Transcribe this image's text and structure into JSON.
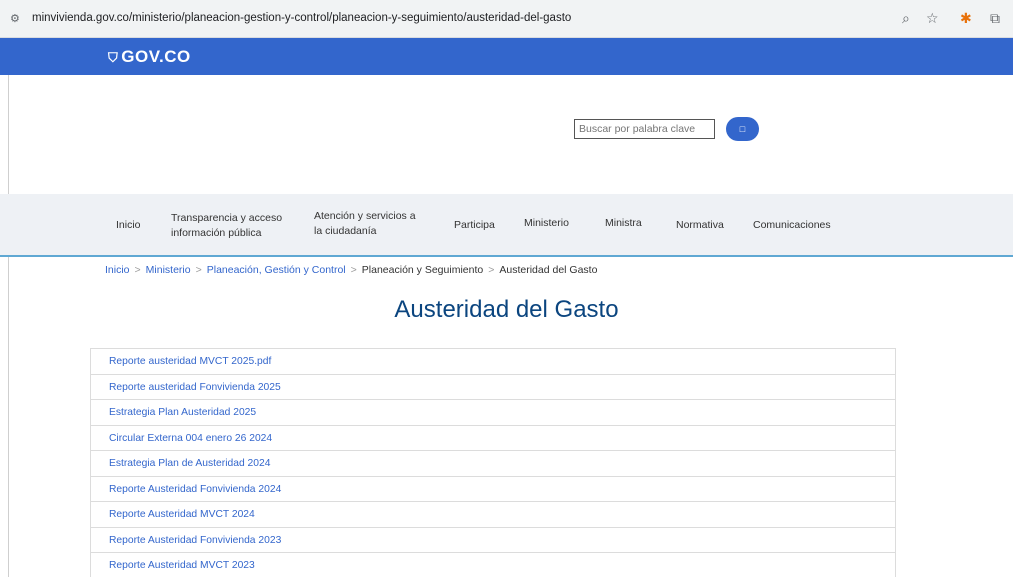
{
  "browser": {
    "url": "minvivienda.gov.co/ministerio/planeacion-gestion-y-control/planeacion-y-seguimiento/austeridad-del-gasto"
  },
  "gov": {
    "logo_text": "GOV.CO"
  },
  "search": {
    "placeholder": "Buscar por palabra clave",
    "button_label": "□"
  },
  "nav": {
    "items": [
      {
        "label": "Inicio"
      },
      {
        "line1": "Transparencia y acceso",
        "line2": "información pública"
      },
      {
        "line1": "Atención y servicios a",
        "line2": "la ciudadanía"
      },
      {
        "label": "Participa"
      },
      {
        "label": "Ministerio"
      },
      {
        "label": "Ministra"
      },
      {
        "label": "Normativa"
      },
      {
        "label": "Comunicaciones"
      }
    ]
  },
  "breadcrumb": {
    "items": [
      "Inicio",
      "Ministerio",
      "Planeación, Gestión y Control",
      "Planeación y Seguimiento",
      "Austeridad del Gasto"
    ],
    "separator": ">"
  },
  "page": {
    "title": "Austeridad del Gasto"
  },
  "documents": [
    "Reporte austeridad MVCT 2025.pdf",
    "Reporte austeridad Fonvivienda 2025",
    "Estrategia Plan Austeridad 2025",
    "Circular Externa 004 enero 26 2024",
    "Estrategia Plan de Austeridad 2024",
    "Reporte Austeridad Fonvivienda 2024",
    "Reporte Austeridad MVCT 2024",
    "Reporte Austeridad Fonvivienda 2023",
    "Reporte Austeridad MVCT 2023"
  ]
}
